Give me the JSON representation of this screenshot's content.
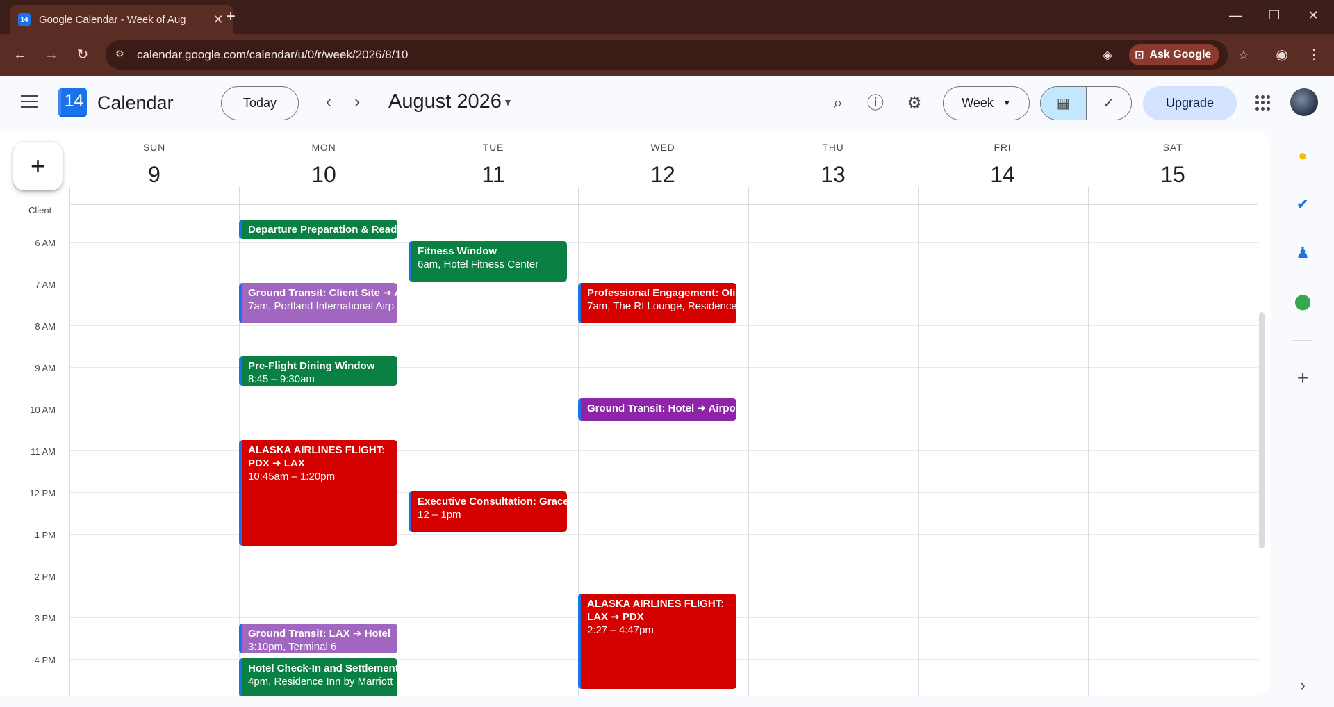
{
  "browser": {
    "tab_title": "Google Calendar - Week of Aug",
    "favicon_text": "14",
    "url": "calendar.google.com/calendar/u/0/r/week/2026/8/10",
    "ask_google": "Ask Google"
  },
  "header": {
    "logo_day": "14",
    "app_title": "Calendar",
    "today_label": "Today",
    "month_label": "August 2026",
    "view_label": "Week",
    "upgrade_label": "Upgrade"
  },
  "grid": {
    "timezone_label": "Client",
    "days": [
      {
        "dow": "SUN",
        "date": "9"
      },
      {
        "dow": "MON",
        "date": "10"
      },
      {
        "dow": "TUE",
        "date": "11"
      },
      {
        "dow": "WED",
        "date": "12"
      },
      {
        "dow": "THU",
        "date": "13"
      },
      {
        "dow": "FRI",
        "date": "14"
      },
      {
        "dow": "SAT",
        "date": "15"
      }
    ],
    "hours": [
      "6 AM",
      "7 AM",
      "8 AM",
      "9 AM",
      "10 AM",
      "11 AM",
      "12 PM",
      "1 PM",
      "2 PM",
      "3 PM",
      "4 PM"
    ]
  },
  "events": [
    {
      "day": "MON",
      "title": "Departure Preparation & Readi",
      "detail": "",
      "color": "#0b8043"
    },
    {
      "day": "MON",
      "title": "Ground Transit: Client Site ➔ A",
      "detail": "7am, Portland International Airp",
      "color": "#a166bf"
    },
    {
      "day": "MON",
      "title": "Pre-Flight Dining Window",
      "detail": "8:45 – 9:30am",
      "color": "#0b8043"
    },
    {
      "day": "MON",
      "title": "ALASKA AIRLINES FLIGHT: PDX ➔ LAX",
      "detail": "10:45am – 1:20pm",
      "color": "#d50000"
    },
    {
      "day": "MON",
      "title": "Ground Transit: LAX ➔ Hotel",
      "detail": "3:10pm, Terminal 6",
      "color": "#a166bf"
    },
    {
      "day": "MON",
      "title": "Hotel Check-In and Settlement",
      "detail": "4pm, Residence Inn by Marriott",
      "color": "#0b8043"
    },
    {
      "day": "TUE",
      "title": "Fitness Window",
      "detail": "6am, Hotel Fitness Center",
      "color": "#0b8043"
    },
    {
      "day": "TUE",
      "title": "Executive Consultation: Grace",
      "detail": "12 – 1pm",
      "color": "#d50000"
    },
    {
      "day": "WED",
      "title": "Professional Engagement: Oliv",
      "detail": "7am, The RI Lounge, Residence",
      "color": "#d50000"
    },
    {
      "day": "WED",
      "title": "Ground Transit: Hotel ➔ Airpor",
      "detail": "",
      "color": "#8e24aa"
    },
    {
      "day": "WED",
      "title": "ALASKA AIRLINES FLIGHT: LAX ➔ PDX",
      "detail": "2:27 – 4:47pm",
      "color": "#d50000"
    }
  ]
}
